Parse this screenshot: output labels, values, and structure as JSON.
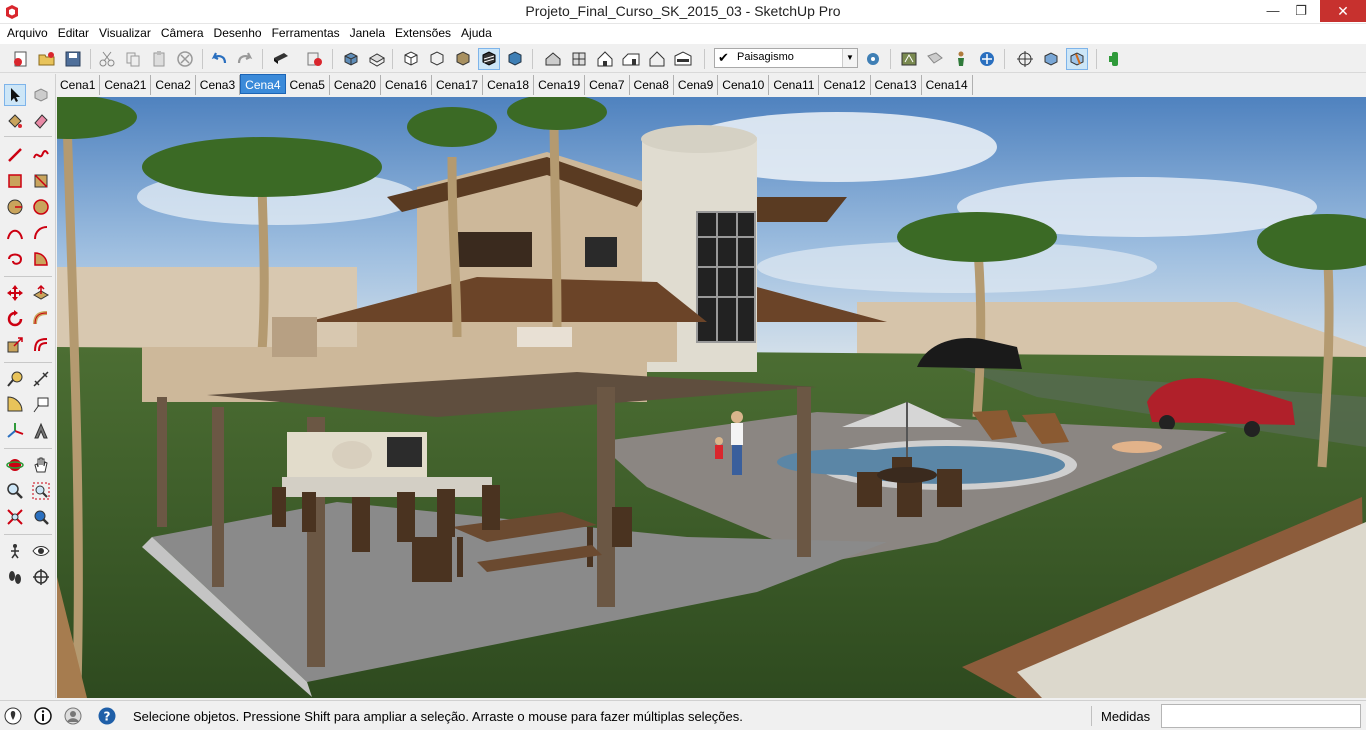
{
  "window": {
    "title": "Projeto_Final_Curso_SK_2015_03 - SketchUp Pro",
    "minimize": "—",
    "maximize": "❐",
    "close": "✕"
  },
  "menu": {
    "items": [
      "Arquivo",
      "Editar",
      "Visualizar",
      "Câmera",
      "Desenho",
      "Ferramentas",
      "Janela",
      "Extensões",
      "Ajuda"
    ]
  },
  "toolbar": {
    "style_checkmark": "✔",
    "style_selected": "Paisagismo",
    "style_arrow": "▼"
  },
  "scenes": {
    "tabs": [
      "Cena1",
      "Cena21",
      "Cena2",
      "Cena3",
      "Cena4",
      "Cena5",
      "Cena20",
      "Cena16",
      "Cena17",
      "Cena18",
      "Cena19",
      "Cena7",
      "Cena8",
      "Cena9",
      "Cena10",
      "Cena11",
      "Cena12",
      "Cena13",
      "Cena14"
    ],
    "active": "Cena4"
  },
  "status": {
    "message": "Selecione objetos. Pressione Shift para ampliar a seleção. Arraste o mouse para fazer múltiplas seleções.",
    "measurements_label": "Medidas",
    "measurements_value": ""
  },
  "colors": {
    "accent": "#3b8ad9",
    "close_button": "#c7312e",
    "sky": "#6f9ccc",
    "grass": "#3f5e2a"
  }
}
